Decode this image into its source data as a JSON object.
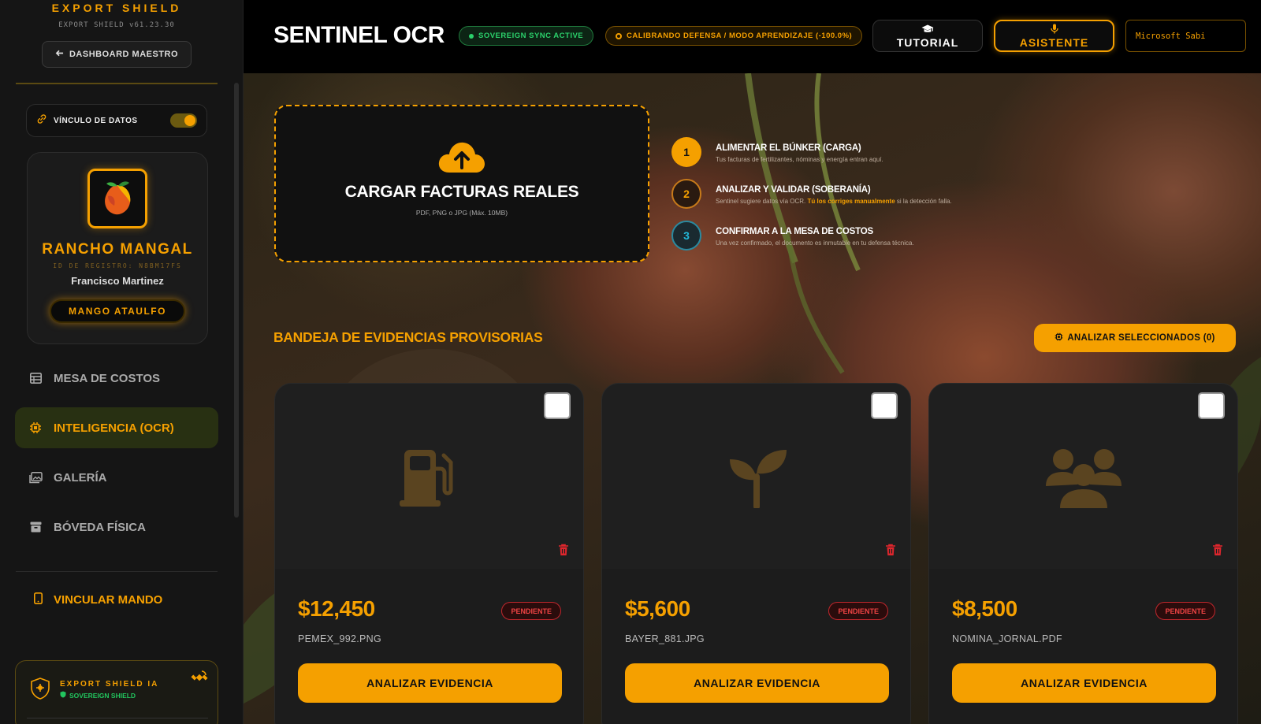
{
  "sidebar": {
    "brand_title": "EXPORT SHIELD",
    "brand_version": "EXPORT SHIELD v61.23.30",
    "dashboard_button": "DASHBOARD MAESTRO",
    "data_link_label": "VÍNCULO DE DATOS",
    "data_link_on": true,
    "profile": {
      "ranch_name": "RANCHO MANGAL",
      "registry_id": "ID DE REGISTRO: N8BM17FS",
      "owner": "Francisco Martinez",
      "crop": "MANGO ATAULFO"
    },
    "nav": [
      {
        "label": "MESA DE COSTOS",
        "icon": "table-icon",
        "active": false
      },
      {
        "label": "INTELIGENCIA (OCR)",
        "icon": "chip-icon",
        "active": true
      },
      {
        "label": "GALERÍA",
        "icon": "gallery-icon",
        "active": false
      },
      {
        "label": "BÓVEDA FÍSICA",
        "icon": "archive-icon",
        "active": false
      }
    ],
    "pair_controller": "VINCULAR MANDO",
    "ia_box": {
      "title": "EXPORT SHIELD IA",
      "subtitle": "SOVEREIGN SHIELD"
    }
  },
  "header": {
    "title": "SENTINEL OCR",
    "sync_badge": "SOVEREIGN SYNC ACTIVE",
    "calibration_badge": "CALIBRANDO DEFENSA / MODO APRENDIZAJE (-100.0%)",
    "tutorial_button": "TUTORIAL",
    "assistant_button": "ASISTENTE",
    "voice_select": "Microsoft Sabi"
  },
  "upload": {
    "title": "CARGAR FACTURAS REALES",
    "subtitle": "PDF, PNG o JPG (Máx. 10MB)"
  },
  "steps": [
    {
      "num": "1",
      "title": "ALIMENTAR EL BÚNKER (CARGA)",
      "desc": "Tus facturas de fertilizantes, nóminas y energía entran aquí.",
      "desc_highlight": "",
      "desc_tail": ""
    },
    {
      "num": "2",
      "title": "ANALIZAR Y VALIDAR (SOBERANÍA)",
      "desc": "Sentinel sugiere datos vía OCR. ",
      "desc_highlight": "Tú los corriges manualmente",
      "desc_tail": " si la detección falla."
    },
    {
      "num": "3",
      "title": "CONFIRMAR A LA MESA DE COSTOS",
      "desc": "Una vez confirmado, el documento es inmutable en tu defensa técnica.",
      "desc_highlight": "",
      "desc_tail": ""
    }
  ],
  "tray": {
    "title": "BANDEJA DE EVIDENCIAS PROVISORIAS",
    "analyze_selected": "ANALIZAR SELECCIONADOS (0)"
  },
  "cards": [
    {
      "icon": "fuel-pump-icon",
      "amount": "$12,450",
      "status": "PENDIENTE",
      "filename": "PEMEX_992.PNG",
      "action": "ANALIZAR EVIDENCIA"
    },
    {
      "icon": "seedling-icon",
      "amount": "$5,600",
      "status": "PENDIENTE",
      "filename": "BAYER_881.JPG",
      "action": "ANALIZAR EVIDENCIA"
    },
    {
      "icon": "users-icon",
      "amount": "$8,500",
      "status": "PENDIENTE",
      "filename": "NOMINA_JORNAL.PDF",
      "action": "ANALIZAR EVIDENCIA"
    }
  ],
  "colors": {
    "accent": "#f5a000",
    "success": "#2bd16b",
    "danger": "#ef4444",
    "step3": "#22b8d8"
  }
}
